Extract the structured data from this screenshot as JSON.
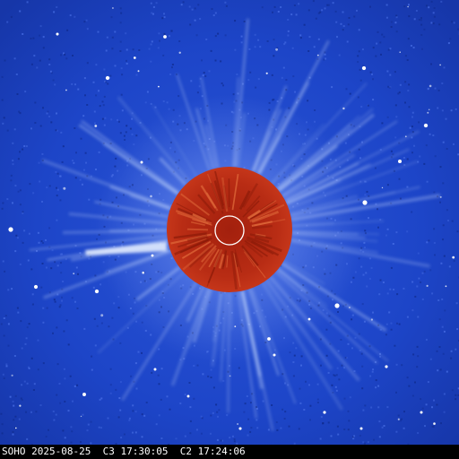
{
  "image": {
    "description_colors": {
      "background": "#1a3fbf",
      "occulter_c2": "#b52a12",
      "sun_circle": "#ffffff",
      "streamer": "#cfe0ff"
    }
  },
  "caption": {
    "observatory": "SOHO",
    "date": "2025-08-25",
    "c3_label": "C3",
    "c3_time": "17:30:05",
    "c2_label": "C2",
    "c2_time": "17:24:06"
  }
}
